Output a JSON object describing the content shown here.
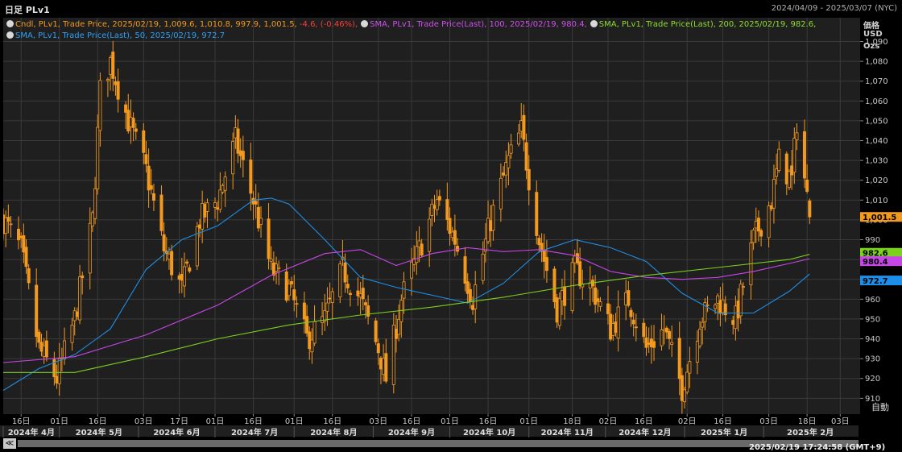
{
  "header": {
    "title": "日足 PLv1",
    "range": "2024/04/09 - 2025/03/07 (NYC)"
  },
  "legend": {
    "candle_prefix": "Cndl, PLv1, Trade Price, 2025/02/19, 1,009.6, 1,010.8, 997.9, 1,001.5,",
    "candle_change": " -4.6, (-0.46%),",
    "sma100": "SMA, PLv1, Trade Price(Last), 100, 2025/02/19, 980.4,",
    "sma200": "SMA, PLv1, Trade Price(Last), 200, 2025/02/19, 982.6,",
    "sma50": "SMA, PLv1, Trade Price(Last), 50, 2025/02/19, 972.7"
  },
  "axis_units": {
    "line1": "価格",
    "line2": "USD",
    "line3": "Ozs"
  },
  "auto_button": "自動",
  "nav_button": "≪",
  "timestamp": "2025/02/19 17:24:58 (GMT+9)",
  "colors": {
    "candle": "#f39a1e",
    "sma100": "#c845e8",
    "sma200": "#7bd11c",
    "sma50": "#1d8fe8",
    "grid": "#3a3a3a",
    "down": "#e24040"
  },
  "chart_data": {
    "type": "candlestick",
    "title": "日足 PLv1",
    "ylabel": "価格 USD Ozs",
    "ylim": [
      902,
      1102
    ],
    "yticks": [
      910,
      920,
      930,
      940,
      950,
      960,
      970,
      980,
      990,
      1000,
      1010,
      1020,
      1030,
      1040,
      1050,
      1060,
      1070,
      1080,
      1090
    ],
    "ytick_labels": [
      "910",
      "920",
      "930",
      "940",
      "950",
      "960",
      "970",
      "980",
      "990",
      "1,000",
      "1,010",
      "1,020",
      "1,030",
      "1,040",
      "1,050",
      "1,060",
      "1,070",
      "1,080",
      "1,090"
    ],
    "x_range": [
      "2024-04-09",
      "2025-03-07"
    ],
    "day_ticks": [
      {
        "date": "2024-04-16",
        "label": "16日"
      },
      {
        "date": "2024-05-01",
        "label": "01日"
      },
      {
        "date": "2024-05-16",
        "label": "16日"
      },
      {
        "date": "2024-06-03",
        "label": "03日"
      },
      {
        "date": "2024-06-17",
        "label": "17日"
      },
      {
        "date": "2024-07-01",
        "label": "01日"
      },
      {
        "date": "2024-07-16",
        "label": "16日"
      },
      {
        "date": "2024-08-01",
        "label": "01日"
      },
      {
        "date": "2024-08-16",
        "label": "16日"
      },
      {
        "date": "2024-09-03",
        "label": "03日"
      },
      {
        "date": "2024-09-16",
        "label": "16日"
      },
      {
        "date": "2024-10-01",
        "label": "01日"
      },
      {
        "date": "2024-10-16",
        "label": "16日"
      },
      {
        "date": "2024-11-01",
        "label": "01日"
      },
      {
        "date": "2024-11-18",
        "label": "18日"
      },
      {
        "date": "2024-12-02",
        "label": "02日"
      },
      {
        "date": "2024-12-16",
        "label": "16日"
      },
      {
        "date": "2025-01-02",
        "label": "02日"
      },
      {
        "date": "2025-01-16",
        "label": "16日"
      },
      {
        "date": "2025-02-03",
        "label": "03日"
      },
      {
        "date": "2025-02-18",
        "label": "18日"
      },
      {
        "date": "2025-03-03",
        "label": "03日"
      }
    ],
    "month_labels": [
      {
        "date": "2024-04-01",
        "label": "2024年 4月"
      },
      {
        "date": "2024-05-01",
        "label": "2024年 5月"
      },
      {
        "date": "2024-06-01",
        "label": "2024年 6月"
      },
      {
        "date": "2024-07-01",
        "label": "2024年 7月"
      },
      {
        "date": "2024-08-01",
        "label": "2024年 8月"
      },
      {
        "date": "2024-09-01",
        "label": "2024年 9月"
      },
      {
        "date": "2024-10-01",
        "label": "2024年 10月"
      },
      {
        "date": "2024-11-01",
        "label": "2024年 11月"
      },
      {
        "date": "2024-12-01",
        "label": "2024年 12月"
      },
      {
        "date": "2025-01-01",
        "label": "2025年 1月"
      },
      {
        "date": "2025-02-01",
        "label": "2025年 2月"
      }
    ],
    "close_path": [
      [
        "2024-04-09",
        1000
      ],
      [
        "2024-04-16",
        985
      ],
      [
        "2024-04-23",
        935
      ],
      [
        "2024-04-30",
        920
      ],
      [
        "2024-05-07",
        950
      ],
      [
        "2024-05-14",
        1000
      ],
      [
        "2024-05-17",
        1065
      ],
      [
        "2024-05-21",
        1080
      ],
      [
        "2024-05-28",
        1050
      ],
      [
        "2024-06-04",
        1025
      ],
      [
        "2024-06-11",
        985
      ],
      [
        "2024-06-18",
        965
      ],
      [
        "2024-06-25",
        1000
      ],
      [
        "2024-07-02",
        1010
      ],
      [
        "2024-07-09",
        1040
      ],
      [
        "2024-07-16",
        1010
      ],
      [
        "2024-07-23",
        975
      ],
      [
        "2024-07-30",
        965
      ],
      [
        "2024-08-06",
        940
      ],
      [
        "2024-08-13",
        950
      ],
      [
        "2024-08-20",
        975
      ],
      [
        "2024-08-27",
        960
      ],
      [
        "2024-09-03",
        935
      ],
      [
        "2024-09-06",
        920
      ],
      [
        "2024-09-12",
        960
      ],
      [
        "2024-09-19",
        985
      ],
      [
        "2024-09-26",
        1010
      ],
      [
        "2024-10-03",
        990
      ],
      [
        "2024-10-10",
        960
      ],
      [
        "2024-10-17",
        1000
      ],
      [
        "2024-10-24",
        1030
      ],
      [
        "2024-10-29",
        1045
      ],
      [
        "2024-11-05",
        990
      ],
      [
        "2024-11-12",
        955
      ],
      [
        "2024-11-19",
        975
      ],
      [
        "2024-11-26",
        965
      ],
      [
        "2024-12-03",
        945
      ],
      [
        "2024-12-10",
        960
      ],
      [
        "2024-12-17",
        935
      ],
      [
        "2024-12-24",
        945
      ],
      [
        "2024-12-31",
        915
      ],
      [
        "2025-01-07",
        950
      ],
      [
        "2025-01-14",
        960
      ],
      [
        "2025-01-21",
        950
      ],
      [
        "2025-01-28",
        990
      ],
      [
        "2025-02-04",
        1010
      ],
      [
        "2025-02-07",
        1030
      ],
      [
        "2025-02-12",
        1020
      ],
      [
        "2025-02-14",
        1050
      ],
      [
        "2025-02-19",
        1001.5
      ]
    ],
    "last_candle": {
      "date": "2025-02-19",
      "open": 1009.6,
      "high": 1010.8,
      "low": 997.9,
      "close": 1001.5,
      "change": -4.6,
      "change_pct": -0.46
    },
    "series": [
      {
        "name": "SMA 50",
        "period": 50,
        "last": 972.7,
        "color": "#1d8fe8",
        "points": [
          [
            "2024-04-09",
            914
          ],
          [
            "2024-04-23",
            925
          ],
          [
            "2024-05-07",
            932
          ],
          [
            "2024-05-21",
            945
          ],
          [
            "2024-06-04",
            975
          ],
          [
            "2024-06-18",
            990
          ],
          [
            "2024-07-02",
            997
          ],
          [
            "2024-07-16",
            1010
          ],
          [
            "2024-07-23",
            1011
          ],
          [
            "2024-07-30",
            1008
          ],
          [
            "2024-08-13",
            990
          ],
          [
            "2024-08-27",
            971
          ],
          [
            "2024-09-10",
            966
          ],
          [
            "2024-09-24",
            962
          ],
          [
            "2024-10-08",
            958
          ],
          [
            "2024-10-22",
            968
          ],
          [
            "2024-11-05",
            984
          ],
          [
            "2024-11-19",
            990
          ],
          [
            "2024-12-03",
            986
          ],
          [
            "2024-12-17",
            979
          ],
          [
            "2024-12-31",
            963
          ],
          [
            "2025-01-14",
            953
          ],
          [
            "2025-01-28",
            953
          ],
          [
            "2025-02-11",
            964
          ],
          [
            "2025-02-19",
            972.7
          ]
        ]
      },
      {
        "name": "SMA 100",
        "period": 100,
        "last": 980.4,
        "color": "#c845e8",
        "points": [
          [
            "2024-04-09",
            928
          ],
          [
            "2024-05-07",
            931
          ],
          [
            "2024-06-04",
            942
          ],
          [
            "2024-07-02",
            957
          ],
          [
            "2024-07-23",
            972
          ],
          [
            "2024-08-13",
            983
          ],
          [
            "2024-08-27",
            985
          ],
          [
            "2024-09-10",
            977
          ],
          [
            "2024-09-24",
            983
          ],
          [
            "2024-10-08",
            986
          ],
          [
            "2024-10-22",
            984
          ],
          [
            "2024-11-05",
            985
          ],
          [
            "2024-11-19",
            982
          ],
          [
            "2024-12-03",
            974
          ],
          [
            "2024-12-17",
            971
          ],
          [
            "2024-12-31",
            970
          ],
          [
            "2025-01-14",
            971
          ],
          [
            "2025-01-28",
            974
          ],
          [
            "2025-02-11",
            978
          ],
          [
            "2025-02-19",
            980.4
          ]
        ]
      },
      {
        "name": "SMA 200",
        "period": 200,
        "last": 982.6,
        "color": "#7bd11c",
        "points": [
          [
            "2024-04-09",
            923
          ],
          [
            "2024-05-07",
            923
          ],
          [
            "2024-06-04",
            931
          ],
          [
            "2024-07-02",
            940
          ],
          [
            "2024-07-30",
            947
          ],
          [
            "2024-08-27",
            952
          ],
          [
            "2024-09-24",
            956
          ],
          [
            "2024-10-22",
            961
          ],
          [
            "2024-11-19",
            967
          ],
          [
            "2024-12-17",
            972
          ],
          [
            "2025-01-14",
            976
          ],
          [
            "2025-02-11",
            980
          ],
          [
            "2025-02-19",
            982.6
          ]
        ]
      }
    ],
    "price_labels": [
      {
        "value": 1001.5,
        "text": "1,001.5",
        "color": "#f39a1e"
      },
      {
        "value": 982.6,
        "text": "982.6",
        "color": "#7bd11c"
      },
      {
        "value": 980.4,
        "text": "980.4",
        "color": "#c845e8"
      },
      {
        "value": 972.7,
        "text": "972.7",
        "color": "#1d8fe8"
      }
    ]
  }
}
